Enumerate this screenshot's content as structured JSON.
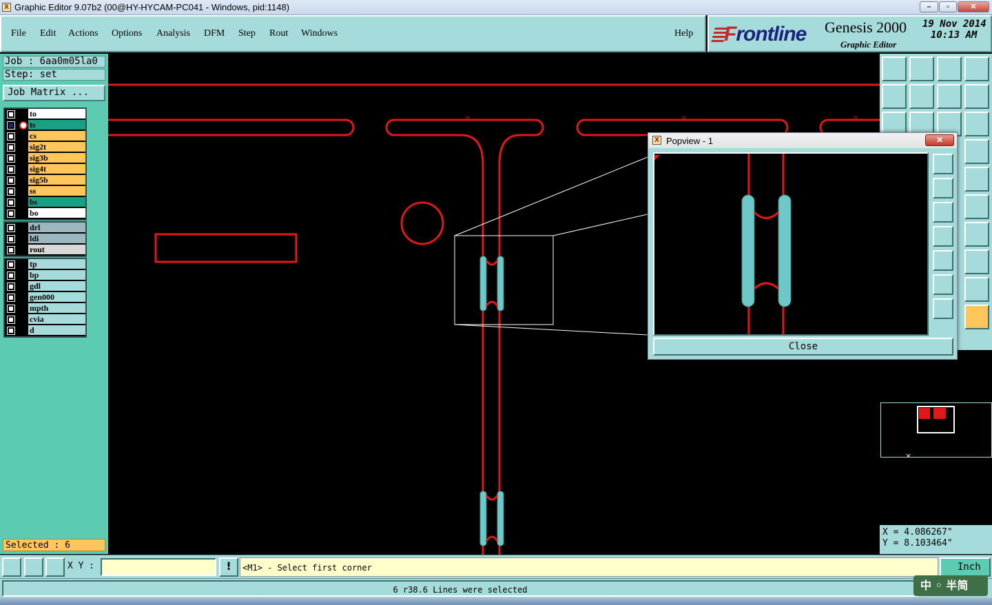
{
  "window": {
    "title": "Graphic Editor 9.07b2 (00@HY-HYCAM-PC041 - Windows, pid:1148)",
    "app_icon": "X"
  },
  "menu": {
    "items": [
      "File",
      "Edit",
      "Actions",
      "Options",
      "Analysis",
      "DFM",
      "Step",
      "Rout",
      "Windows"
    ],
    "help": "Help"
  },
  "brand": {
    "logo": "Frontline",
    "product": "Genesis 2000",
    "subtitle": "Graphic Editor",
    "date": "19 Nov 2014",
    "time": "10:13 AM"
  },
  "job": {
    "job_label": "Job : 6aa0m05la0",
    "step_label": "Step: set",
    "matrix_button": "Job Matrix ..."
  },
  "layers": {
    "group1": [
      {
        "name": "to",
        "color": "#ffffff"
      },
      {
        "name": "ts",
        "color": "#1aa185"
      },
      {
        "name": "cs",
        "color": "#ffc65c"
      },
      {
        "name": "sig2t",
        "color": "#ffc65c"
      },
      {
        "name": "sig3b",
        "color": "#ffc65c"
      },
      {
        "name": "sig4t",
        "color": "#ffc65c"
      },
      {
        "name": "sig5b",
        "color": "#ffc65c"
      },
      {
        "name": "ss",
        "color": "#ffc65c"
      },
      {
        "name": "bs",
        "color": "#1aa185"
      },
      {
        "name": "bo",
        "color": "#ffffff"
      }
    ],
    "group2": [
      {
        "name": "drl",
        "color": "#9ab8c0"
      },
      {
        "name": "ldi",
        "color": "#9ab8c0"
      },
      {
        "name": "rout",
        "color": "#d8d8d8"
      }
    ],
    "group3": [
      {
        "name": "tp",
        "color": "#a6dbdb"
      },
      {
        "name": "bp",
        "color": "#a6dbdb"
      },
      {
        "name": "gdl",
        "color": "#a6dbdb"
      },
      {
        "name": "gen000",
        "color": "#a6dbdb"
      },
      {
        "name": "mpth",
        "color": "#a6dbdb"
      },
      {
        "name": "cvia",
        "color": "#a6dbdb"
      },
      {
        "name": "d",
        "color": "#a6dbdb"
      }
    ]
  },
  "selection": {
    "label": "Selected : 6"
  },
  "canvas": {
    "pad_labels": [
      "0",
      "0",
      "0"
    ],
    "colors": {
      "trace": "#e01818",
      "highlight": "#6fc8c8",
      "outline": "#ffffff"
    }
  },
  "popview": {
    "title": "Popview - 1",
    "close_x": "✕",
    "close_button": "Close"
  },
  "coords": {
    "x": "X = 4.086267\"",
    "y": "Y = 8.103464\""
  },
  "command": {
    "xy_label": "X Y :",
    "xy_value": "",
    "prompt": "<M1> - Select first corner",
    "unit": "Inch",
    "status": "6 r38.6 Lines were selected"
  },
  "ime": {
    "label": "中 ◦ 半简"
  }
}
